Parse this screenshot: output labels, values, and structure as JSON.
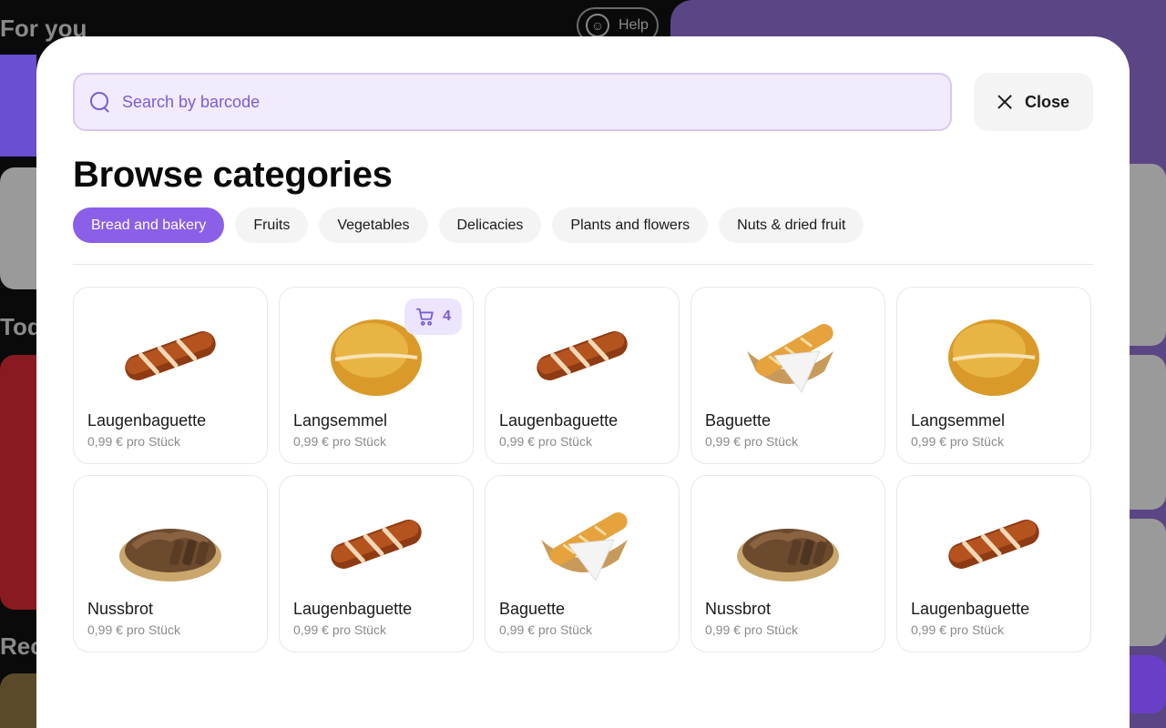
{
  "background": {
    "section_for_you": "For you",
    "section_today": "Tod",
    "section_recent": "Rec",
    "help_label": "Help"
  },
  "search": {
    "placeholder": "Search by barcode",
    "value": ""
  },
  "close_button": {
    "label": "Close"
  },
  "heading": "Browse categories",
  "categories": [
    {
      "label": "Bread and bakery",
      "active": true
    },
    {
      "label": "Fruits",
      "active": false
    },
    {
      "label": "Vegetables",
      "active": false
    },
    {
      "label": "Delicacies",
      "active": false
    },
    {
      "label": "Plants and flowers",
      "active": false
    },
    {
      "label": "Nuts & dried fruit",
      "active": false
    }
  ],
  "products": [
    {
      "name": "Laugenbaguette",
      "price": "0,99 € pro Stück",
      "image": "pretzel-baguette",
      "cart_count": null
    },
    {
      "name": "Langsemmel",
      "price": "0,99 € pro Stück",
      "image": "bread-roll",
      "cart_count": "4"
    },
    {
      "name": "Laugenbaguette",
      "price": "0,99 € pro Stück",
      "image": "pretzel-baguette",
      "cart_count": null
    },
    {
      "name": "Baguette",
      "price": "0,99 € pro Stück",
      "image": "baguette-basket",
      "cart_count": null
    },
    {
      "name": "Langsemmel",
      "price": "0,99 € pro Stück",
      "image": "bread-roll",
      "cart_count": null
    },
    {
      "name": "Nussbrot",
      "price": "0,99 € pro Stück",
      "image": "nut-bread-basket",
      "cart_count": null
    },
    {
      "name": "Laugenbaguette",
      "price": "0,99 € pro Stück",
      "image": "pretzel-baguette",
      "cart_count": null
    },
    {
      "name": "Baguette",
      "price": "0,99 € pro Stück",
      "image": "baguette-basket",
      "cart_count": null
    },
    {
      "name": "Nussbrot",
      "price": "0,99 € pro Stück",
      "image": "nut-bread-basket",
      "cart_count": null
    },
    {
      "name": "Laugenbaguette",
      "price": "0,99 € pro Stück",
      "image": "pretzel-baguette",
      "cart_count": null
    }
  ],
  "colors": {
    "accent": "#8b5fe8",
    "search_bg": "#f1ebfd",
    "chip_bg": "#f4f4f4",
    "price_text": "#8a8a8a"
  }
}
